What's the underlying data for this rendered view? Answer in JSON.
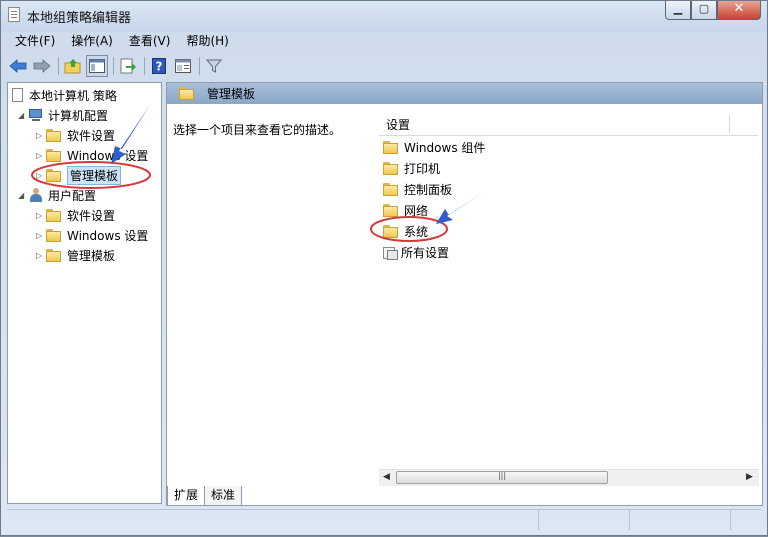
{
  "window": {
    "title": "本地组策略编辑器"
  },
  "menu": [
    "文件(F)",
    "操作(A)",
    "查看(V)",
    "帮助(H)"
  ],
  "toolbar": [
    "back-icon",
    "forward-icon",
    "up-folder-icon",
    "show-hide-tree-icon",
    "export-icon",
    "help-icon",
    "properties-icon",
    "filter-icon"
  ],
  "tree": {
    "root": "本地计算机 策略",
    "computer": {
      "label": "计算机配置",
      "children": [
        "软件设置",
        "Windows 设置",
        "管理模板"
      ]
    },
    "user": {
      "label": "用户配置",
      "children": [
        "软件设置",
        "Windows 设置",
        "管理模板"
      ]
    }
  },
  "detail": {
    "header": "管理模板",
    "description": "选择一个项目来查看它的描述。",
    "column": "设置",
    "items": [
      "Windows 组件",
      "打印机",
      "控制面板",
      "网络",
      "系统",
      "所有设置"
    ]
  },
  "tabs": [
    "扩展",
    "标准"
  ],
  "scrollbar": {
    "thumb_glyph": "|||"
  },
  "annotation_color": "#d63a3a",
  "arrow_color": "#2f5fc8"
}
